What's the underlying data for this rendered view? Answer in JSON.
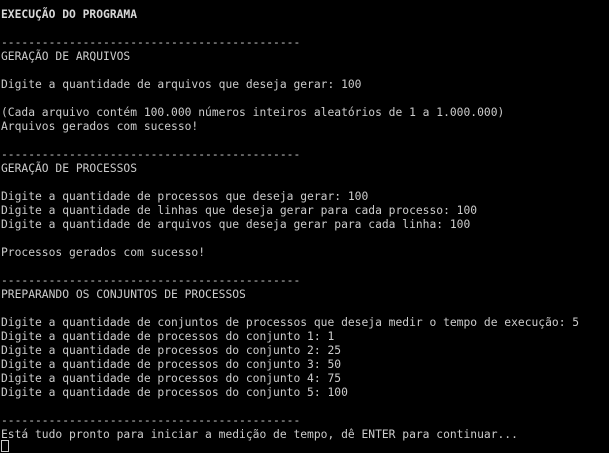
{
  "terminal": {
    "title": "EXECUÇÃO DO PROGRAMA",
    "separator": "--------------------------------------------",
    "section_files": {
      "heading": "GERAÇÃO DE ARQUIVOS",
      "prompt_count": "Digite a quantidade de arquivos que deseja gerar: 100",
      "info": "(Cada arquivo contém 100.000 números inteiros aleatórios de 1 a 1.000.000)",
      "success": "Arquivos gerados com sucesso!"
    },
    "section_processes": {
      "heading": "GERAÇÃO DE PROCESSOS",
      "prompt_processes": "Digite a quantidade de processos que deseja gerar: 100",
      "prompt_lines": "Digite a quantidade de linhas que deseja gerar para cada processo: 100",
      "prompt_files_per_line": "Digite a quantidade de arquivos que deseja gerar para cada linha: 100",
      "success": "Processos gerados com sucesso!"
    },
    "section_sets": {
      "heading": "PREPARANDO OS CONJUNTOS DE PROCESSOS",
      "prompt_sets": "Digite a quantidade de conjuntos de processos que deseja medir o tempo de execução: 5",
      "set_1": "Digite a quantidade de processos do conjunto 1: 1",
      "set_2": "Digite a quantidade de processos do conjunto 2: 25",
      "set_3": "Digite a quantidade de processos do conjunto 3: 50",
      "set_4": "Digite a quantidade de processos do conjunto 4: 75",
      "set_5": "Digite a quantidade de processos do conjunto 5: 100"
    },
    "final_prompt": "Está tudo pronto para iniciar a medição de tempo, dê ENTER para continuar...",
    "colors": {
      "background": "#000000",
      "text": "#cccccc"
    }
  }
}
